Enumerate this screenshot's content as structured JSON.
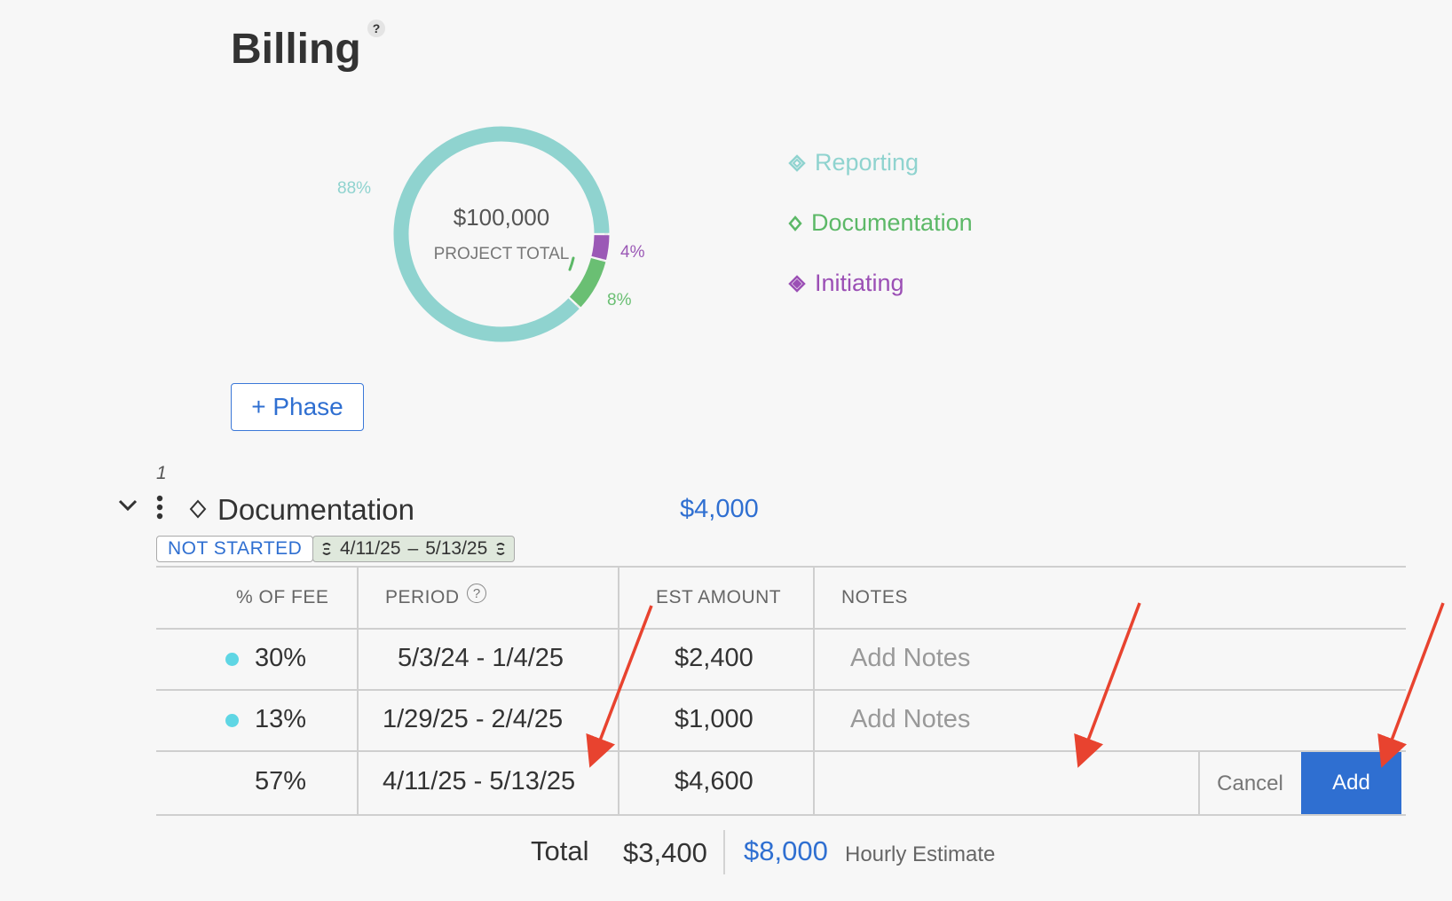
{
  "header": {
    "title": "Billing",
    "help": "?"
  },
  "summary": {
    "total_value": "$100,000",
    "total_label": "PROJECT TOTAL",
    "segments": [
      {
        "name": "Reporting",
        "percent": 88,
        "label": "88%",
        "color": "#8fd3cf"
      },
      {
        "name": "Documentation",
        "percent": 8,
        "label": "8%",
        "color": "#6abf73"
      },
      {
        "name": "Initiating",
        "percent": 4,
        "label": "4%",
        "color": "#9b59b6"
      }
    ]
  },
  "legend": [
    {
      "label": "Reporting",
      "color": "#8fd3cf"
    },
    {
      "label": "Documentation",
      "color": "#5cb867"
    },
    {
      "label": "Initiating",
      "color": "#9b4fb5"
    }
  ],
  "actions": {
    "add_phase": "+ Phase"
  },
  "phase": {
    "index": "1",
    "title": "Documentation",
    "amount": "$4,000",
    "status": "NOT STARTED",
    "start_date": "4/11/25",
    "separator": "–",
    "end_date": "5/13/25"
  },
  "table": {
    "headers": {
      "fee": "% OF FEE",
      "period": "PERIOD",
      "amount": "EST AMOUNT",
      "notes": "NOTES"
    },
    "period_help": "?",
    "rows": [
      {
        "fee": "30%",
        "period": "5/3/24 - 1/4/25",
        "amount": "$2,400",
        "notes": "Add Notes"
      },
      {
        "fee": "13%",
        "period": "1/29/25 - 2/4/25",
        "amount": "$1,000",
        "notes": "Add Notes"
      }
    ],
    "new_row": {
      "fee": "57%",
      "period": "4/11/25 - 5/13/25",
      "amount": "$4,600",
      "cancel": "Cancel",
      "add": "Add"
    }
  },
  "totals": {
    "label": "Total",
    "value": "$3,400",
    "hourly_value": "$8,000",
    "hourly_label": "Hourly Estimate"
  },
  "colors": {
    "accent": "#2f6fd1",
    "annotation": "#e8432f",
    "dot": "#5fd6e4"
  }
}
